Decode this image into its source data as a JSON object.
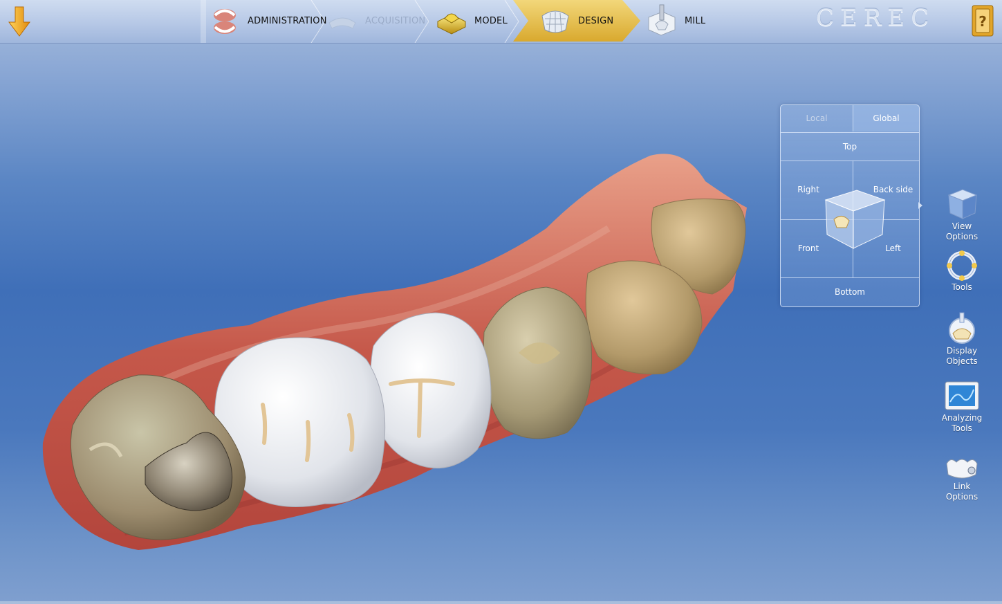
{
  "brand": "CEREC",
  "workflow": {
    "steps": [
      {
        "label": "ADMINISTRATION",
        "state": "done",
        "icon": "denture-icon"
      },
      {
        "label": "ACQUISITION",
        "state": "disabled",
        "icon": "scan-icon"
      },
      {
        "label": "MODEL",
        "state": "done",
        "icon": "model-icon"
      },
      {
        "label": "DESIGN",
        "state": "active",
        "icon": "crown-design-icon"
      },
      {
        "label": "MILL",
        "state": "pending",
        "icon": "mill-icon"
      }
    ]
  },
  "view_panel": {
    "tabs": [
      {
        "label": "Local",
        "selected": false
      },
      {
        "label": "Global",
        "selected": true
      }
    ],
    "top": "Top",
    "right": "Right",
    "back_side": "Back side",
    "front": "Front",
    "left": "Left",
    "bottom": "Bottom"
  },
  "side_tools": [
    {
      "line1": "View",
      "line2": "Options",
      "icon": "view-cube-icon"
    },
    {
      "line1": "Tools",
      "line2": "",
      "icon": "tools-ring-icon"
    },
    {
      "line1": "Display",
      "line2": "Objects",
      "icon": "display-objects-icon"
    },
    {
      "line1": "Analyzing",
      "line2": "Tools",
      "icon": "analyzing-monitor-icon"
    },
    {
      "line1": "Link",
      "line2": "Options",
      "icon": "link-teeth-icon"
    }
  ],
  "colors": {
    "active_step": "#e8c14a",
    "accent_arrow": "#f2a81a",
    "background_top": "#a9bfdc",
    "background_mid": "#3f6fb8"
  }
}
